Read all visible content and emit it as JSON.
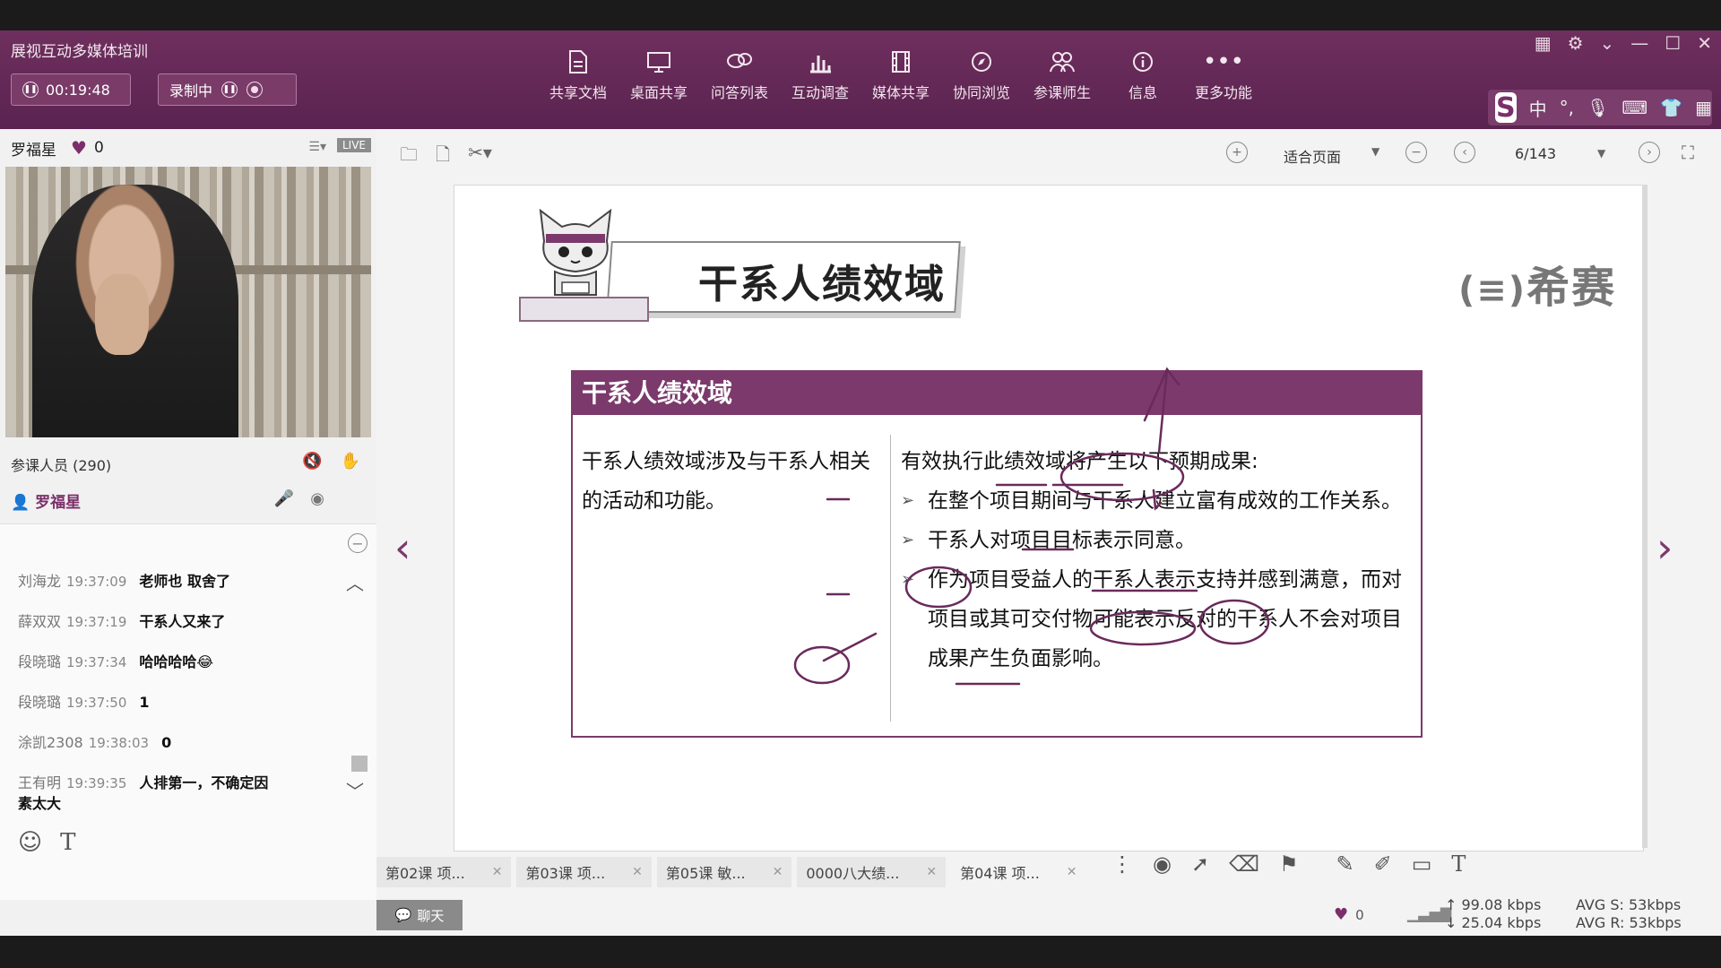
{
  "window": {
    "title": "展视互动多媒体培训",
    "timer": "00:19:48",
    "record_label": "录制中"
  },
  "toolbar": {
    "items": [
      {
        "label": "共享文档",
        "icon": "document-icon"
      },
      {
        "label": "桌面共享",
        "icon": "monitor-icon"
      },
      {
        "label": "问答列表",
        "icon": "chat-bubbles-icon"
      },
      {
        "label": "互动调查",
        "icon": "bar-chart-icon"
      },
      {
        "label": "媒体共享",
        "icon": "film-icon"
      },
      {
        "label": "协同浏览",
        "icon": "compass-icon"
      },
      {
        "label": "参课师生",
        "icon": "users-icon"
      },
      {
        "label": "信息",
        "icon": "info-icon"
      },
      {
        "label": "更多功能",
        "icon": "more-icon"
      }
    ]
  },
  "ime": {
    "lang": "中",
    "logo": "S"
  },
  "presenter": {
    "name": "罗福星",
    "likes": "0",
    "live_badge": "LIVE"
  },
  "participants": {
    "label": "参课人员 (290)",
    "teacher": "罗福星"
  },
  "chat": {
    "messages": [
      {
        "who": "刘海龙",
        "time": "19:37:09",
        "text": "老师也 取舍了"
      },
      {
        "who": "薛双双",
        "time": "19:37:19",
        "text": "干系人又来了"
      },
      {
        "who": "段晓璐",
        "time": "19:37:34",
        "text": "哈哈哈哈😂"
      },
      {
        "who": "段晓璐",
        "time": "19:37:50",
        "text": "1"
      },
      {
        "who": "涂凯2308",
        "time": "19:38:03",
        "text": "0"
      },
      {
        "who": "王有明",
        "time": "19:39:35",
        "text": "人排第一，不确定因"
      },
      {
        "who": "",
        "time": "",
        "text": "素太大"
      }
    ]
  },
  "doc_toolbar": {
    "fit_label": "适合页面",
    "page": "6/143"
  },
  "slide": {
    "title": "干系人绩效域",
    "brand": "希赛",
    "box_title": "干系人绩效域",
    "left_text": "干系人绩效域涉及与干系人相关的活动和功能。",
    "intro": "有效执行此绩效域将产生以下预期成果:",
    "bullets": [
      "在整个项目期间与干系人建立富有成效的工作关系。",
      "干系人对项目目标表示同意。",
      "作为项目受益人的干系人表示支持并感到满意，而对项目或其可交付物可能表示反对的干系人不会对项目成果产生负面影响。"
    ]
  },
  "tabs": [
    {
      "label": "第02课 项..."
    },
    {
      "label": "第03课 项..."
    },
    {
      "label": "第05课 敏..."
    },
    {
      "label": "0000八大绩..."
    },
    {
      "label": "第04课 项..."
    }
  ],
  "status": {
    "chat_btn": "聊天",
    "likes": "0",
    "up_rate": "↑ 99.08 kbps",
    "down_rate": "↓ 25.04 kbps",
    "avg_s": "AVG S: 53kbps",
    "avg_r": "AVG R: 53kbps"
  },
  "colors": {
    "brand": "#6f2f5e",
    "accent": "#7b3a6b"
  }
}
